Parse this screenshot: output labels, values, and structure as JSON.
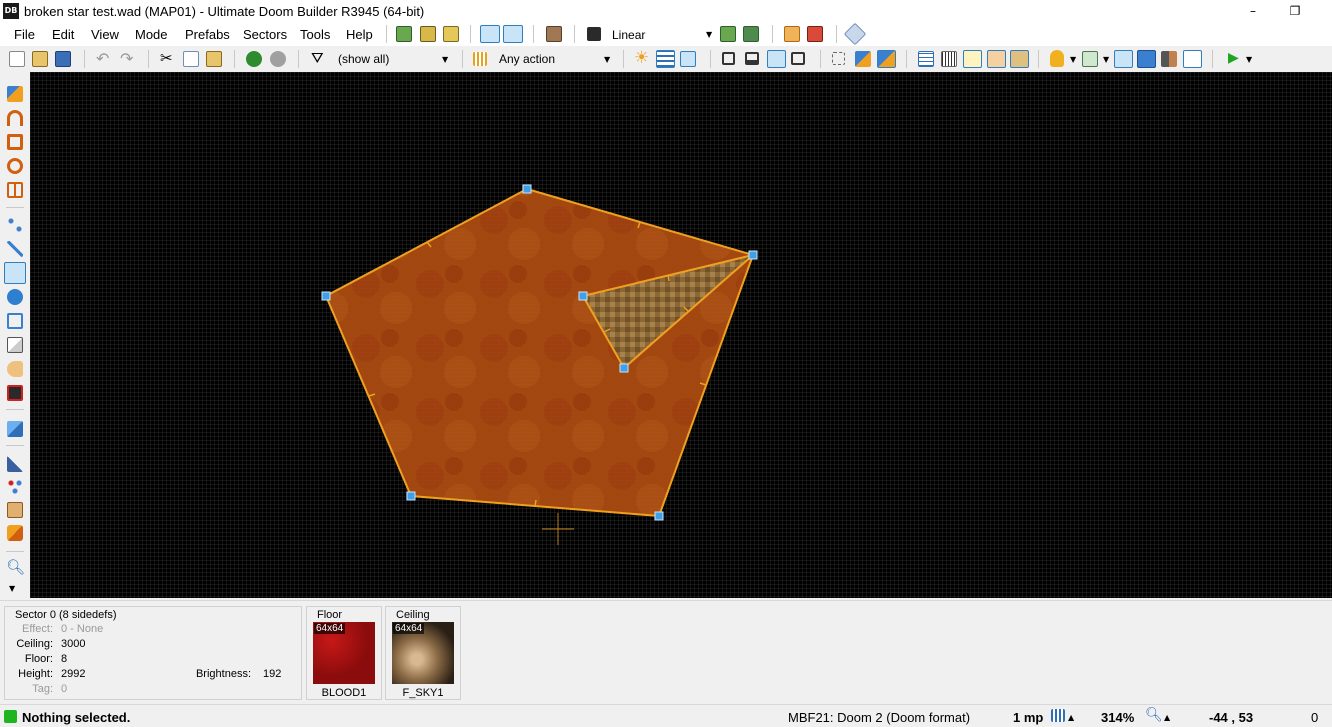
{
  "window": {
    "app_icon_text": "DB",
    "title": "broken star test.wad (MAP01) - Ultimate Doom Builder R3945 (64-bit)",
    "minimize": "–",
    "restore": "❐"
  },
  "menu": [
    "File",
    "Edit",
    "View",
    "Mode",
    "Prefabs",
    "Sectors",
    "Tools",
    "Help"
  ],
  "toolbar": {
    "filtering_mode": "Linear",
    "things_filter": "(show all)",
    "linedef_filter": "Any action"
  },
  "colors": {
    "sector_fill": "#b85312",
    "sector_edge": "#f0a020",
    "vertex": "#3f9fe8",
    "canvas_bg": "#000000",
    "status_ok": "#1fb51f"
  },
  "sector_info": {
    "title": "Sector 0 (8 sidedefs)",
    "effect_label": "Effect:",
    "effect_value": "0 - None",
    "ceiling_label": "Ceiling:",
    "ceiling_value": "3000",
    "floor_label": "Floor:",
    "floor_value": "8",
    "height_label": "Height:",
    "height_value": "2992",
    "tag_label": "Tag:",
    "tag_value": "0",
    "brightness_label": "Brightness:",
    "brightness_value": "192"
  },
  "floor_texture": {
    "title": "Floor",
    "size": "64x64",
    "name": "BLOOD1"
  },
  "ceiling_texture": {
    "title": "Ceiling",
    "size": "64x64",
    "name": "F_SKY1"
  },
  "status": {
    "message": "Nothing selected.",
    "format": "MBF21: Doom 2 (Doom format)",
    "grid": "1 mp",
    "zoom": "314%",
    "coords": "-44 , 53",
    "extra": "0"
  }
}
